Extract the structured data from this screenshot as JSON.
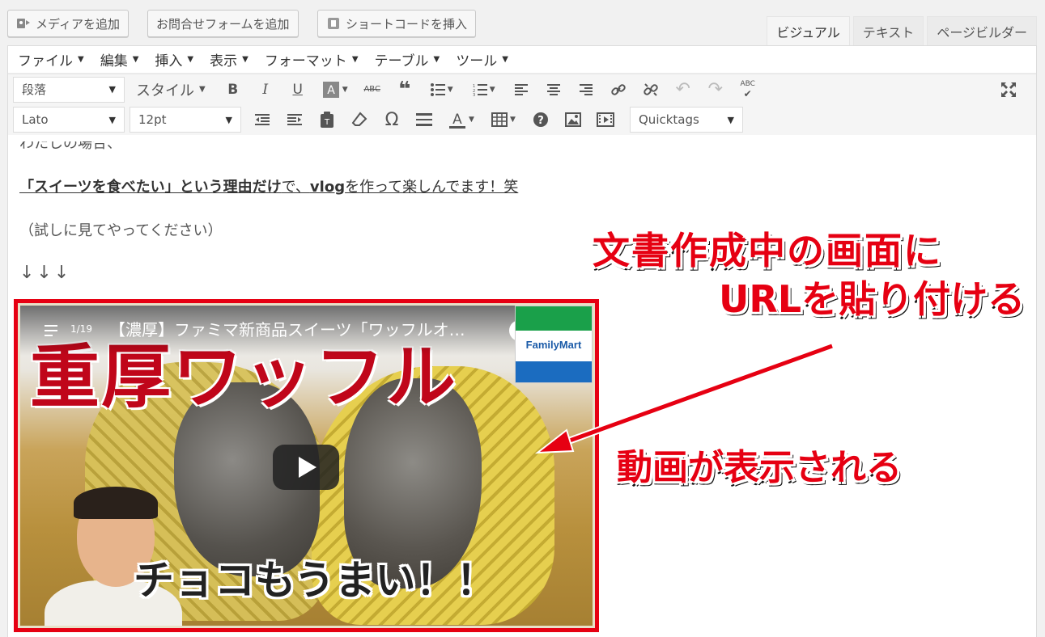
{
  "media_buttons": {
    "add_media": "メディアを追加",
    "add_contact_form": "お問合せフォームを追加",
    "insert_shortcode": "ショートコードを挿入"
  },
  "editor_tabs": [
    "ビジュアル",
    "テキスト",
    "ページビルダー"
  ],
  "menubar": [
    "ファイル",
    "編集",
    "挿入",
    "表示",
    "フォーマット",
    "テーブル",
    "ツール"
  ],
  "toolbar1": {
    "format_select": "段落",
    "style_select": "スタイル"
  },
  "toolbar2": {
    "font_select": "Lato",
    "size_select": "12pt",
    "quicktags_select": "Quicktags"
  },
  "content": {
    "line1": "わたしの場合、",
    "line2_bold": "「スイーツを食べたい」という理由だけ",
    "line2_mid": "で、",
    "line2_bold2": "vlog",
    "line2_rest": "を作って楽しんでます！笑",
    "line3": "（試しに見てやってください）",
    "line4": "↓↓↓"
  },
  "video": {
    "count": "1/19",
    "title": "【濃厚】ファミマ新商品スイーツ「ワッフルオ…",
    "thumb_title": "重厚ワッフル",
    "logo_text": "FamilyMart",
    "caption": "チョコもうまい！！"
  },
  "annotations": {
    "line1": "文書作成中の画面に",
    "line2": "URLを貼り付ける",
    "line3": "動画が表示される"
  },
  "colors": {
    "annotation_red": "#e60012",
    "familymart_green": "#1aa04a",
    "familymart_blue": "#1b6cc0"
  }
}
